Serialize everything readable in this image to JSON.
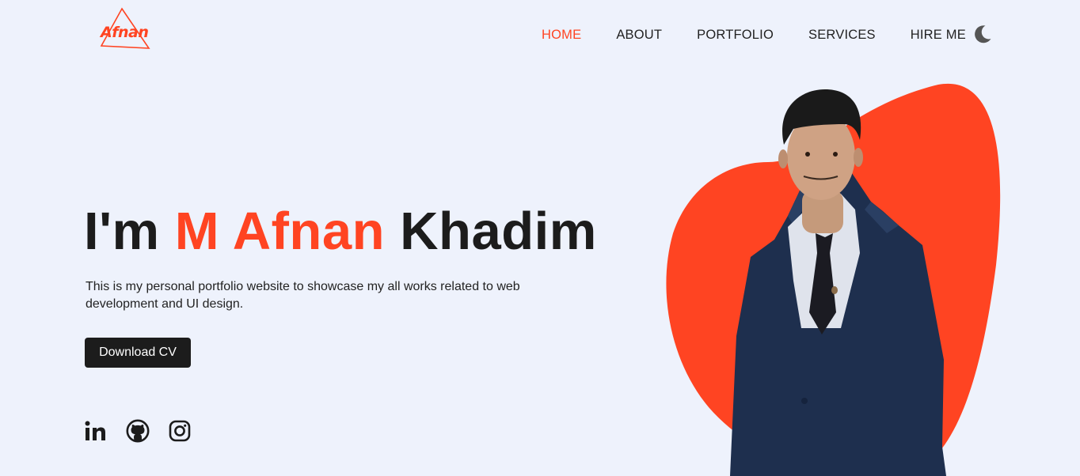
{
  "header": {
    "logo_text": "Afnan",
    "nav": [
      {
        "label": "HOME",
        "active": true
      },
      {
        "label": "ABOUT",
        "active": false
      },
      {
        "label": "PORTFOLIO",
        "active": false
      },
      {
        "label": "SERVICES",
        "active": false
      },
      {
        "label": "HIRE ME",
        "active": false
      }
    ],
    "theme_toggle_icon": "moon-icon"
  },
  "hero": {
    "title_prefix": "I'm ",
    "title_highlight": "M Afnan",
    "title_suffix": " Khadim",
    "description": "This is my personal portfolio website to showcase my all works related to web development and UI design.",
    "cta_label": "Download CV",
    "socials": [
      "linkedin-icon",
      "github-icon",
      "instagram-icon"
    ],
    "image": "portrait-photo"
  },
  "colors": {
    "accent": "#ff4422",
    "background": "#eef2fc",
    "text": "#1c1c1c"
  }
}
